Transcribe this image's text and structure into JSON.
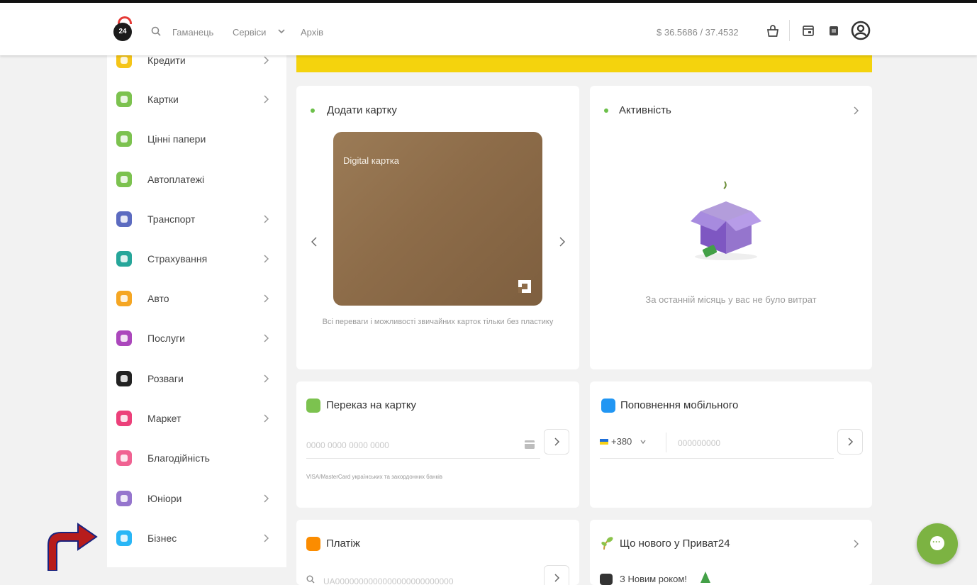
{
  "header": {
    "logo_text": "24",
    "nav": [
      "Гаманець",
      "Сервіси",
      "Архів"
    ],
    "rate": "$ 36.5686 / 37.4532"
  },
  "sidebar": {
    "items": [
      {
        "label": "Кредити",
        "color": "#f5c518",
        "chevron": true
      },
      {
        "label": "Картки",
        "color": "#7cc24f",
        "chevron": true
      },
      {
        "label": "Цінні папери",
        "color": "#7cc24f",
        "chevron": false
      },
      {
        "label": "Автоплатежі",
        "color": "#7cc24f",
        "chevron": false
      },
      {
        "label": "Транспорт",
        "color": "#5c6bc0",
        "chevron": true
      },
      {
        "label": "Страхування",
        "color": "#26a69a",
        "chevron": true
      },
      {
        "label": "Авто",
        "color": "#f5a623",
        "chevron": true
      },
      {
        "label": "Послуги",
        "color": "#ab47bc",
        "chevron": true
      },
      {
        "label": "Розваги",
        "color": "#222222",
        "chevron": true
      },
      {
        "label": "Маркет",
        "color": "#ec407a",
        "chevron": true
      },
      {
        "label": "Благодійність",
        "color": "#f06292",
        "chevron": false
      },
      {
        "label": "Юніори",
        "color": "#9575cd",
        "chevron": true
      },
      {
        "label": "Бізнес",
        "color": "#29b6f6",
        "chevron": true
      }
    ]
  },
  "add_card": {
    "title": "Додати картку",
    "card_label": "Digital картка",
    "description": "Всі переваги і можливості звичайних карток тільки без пластику"
  },
  "activity": {
    "title": "Активність",
    "empty_text": "За останній місяць у вас не було витрат"
  },
  "transfer": {
    "title": "Переказ на картку",
    "placeholder": "0000 0000 0000 0000",
    "hint": "VISA/MasterCard українських та закордонних банків"
  },
  "mobile": {
    "title": "Поповнення мобільного",
    "code": "+380",
    "placeholder": "000000000"
  },
  "payment": {
    "title": "Платіж",
    "placeholder": "UA0000000000000000000000000"
  },
  "news": {
    "title": "Що нового у Приват24",
    "item": "З Новим роком!"
  },
  "colors": {
    "accent_yellow": "#f4d30d",
    "accent_green": "#7cb342",
    "arrow_red": "#c62828"
  }
}
